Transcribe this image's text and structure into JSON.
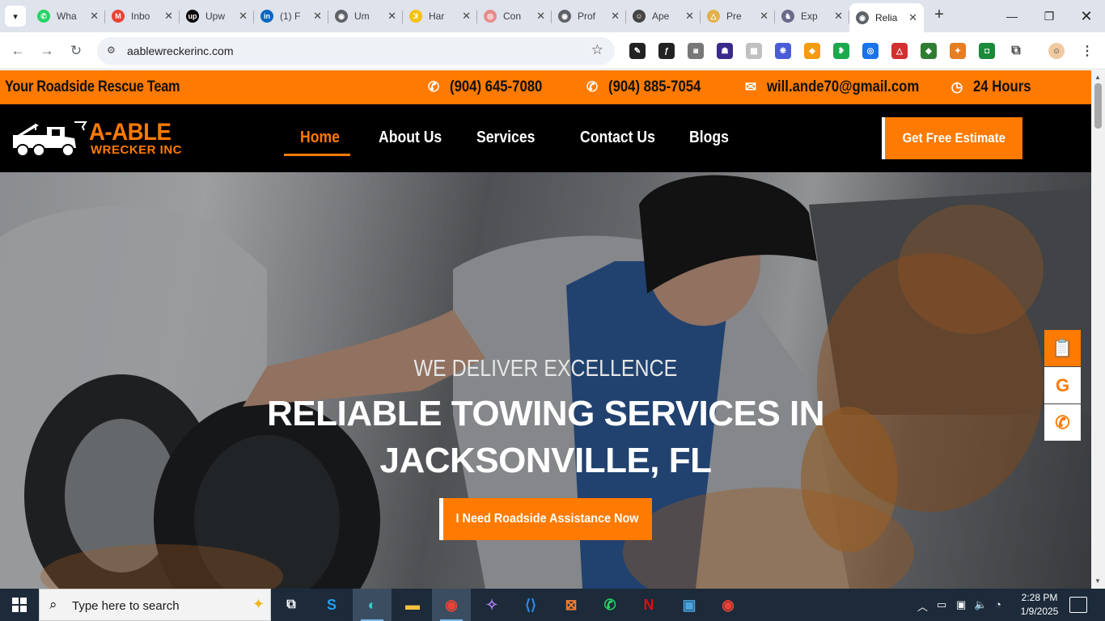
{
  "browser": {
    "tabs": [
      {
        "title": "Wha",
        "color": "#25d366",
        "glyph": "✆"
      },
      {
        "title": "Inbo",
        "color": "#ea4335",
        "glyph": "M"
      },
      {
        "title": "Upw",
        "color": "#000000",
        "glyph": "up"
      },
      {
        "title": "(1) F",
        "color": "#0a66c2",
        "glyph": "in"
      },
      {
        "title": "Um",
        "color": "#5f6368",
        "glyph": "◉"
      },
      {
        "title": "Har",
        "color": "#f4c20d",
        "glyph": "ꓘ"
      },
      {
        "title": "Con",
        "color": "#e88b8b",
        "glyph": "◎"
      },
      {
        "title": "Prof",
        "color": "#5f6368",
        "glyph": "◉"
      },
      {
        "title": "Ape",
        "color": "#444444",
        "glyph": "☺"
      },
      {
        "title": "Pre",
        "color": "#e3b04b",
        "glyph": "△"
      },
      {
        "title": "Exp",
        "color": "#6a6a8a",
        "glyph": "♞"
      },
      {
        "title": "Relia",
        "color": "#5f6368",
        "glyph": "◉",
        "active": true
      }
    ],
    "tab_close": "✕",
    "new_tab": "+",
    "url": "aablewreckerinc.com",
    "extension_colors": [
      "#222222",
      "#222222",
      "#777777",
      "#3a2a8a",
      "#c0c0c0",
      "#4a5bd6",
      "#f39c12",
      "#1ba94c",
      "#1a73e8",
      "#d32f2f",
      "#2e7d32",
      "#e67e22",
      "#1b8a3a",
      "#444444",
      "#555555"
    ]
  },
  "site": {
    "topbar": {
      "tagline": "Your Roadside Rescue Team",
      "phone1": "(904) 645-7080",
      "phone2": "(904) 885-7054",
      "email": "will.ande70@gmail.com",
      "hours": "24 Hours"
    },
    "logo": {
      "line1": "A-ABLE",
      "line2": "WRECKER INC"
    },
    "nav": [
      "Home",
      "About Us",
      "Services",
      "Contact Us",
      "Blogs"
    ],
    "nav_active": "Home",
    "estimate_button": "Get Free Estimate",
    "hero": {
      "pretitle": "WE DELIVER EXCELLENCE",
      "title_line1": "RELIABLE TOWING SERVICES IN",
      "title_line2": "JACKSONVILLE, FL",
      "cta": "I Need Roadside Assistance Now"
    },
    "side_icons": [
      "clipboard-icon",
      "google-icon",
      "phone-icon"
    ],
    "brand_color": "#ff7a00"
  },
  "taskbar": {
    "search_placeholder": "Type here to search",
    "time": "2:28 PM",
    "date": "1/9/2025",
    "apps": [
      "task-view",
      "skype",
      "edge",
      "file-explorer",
      "chrome",
      "copilot",
      "vscode",
      "xampp",
      "whatsapp",
      "netflix",
      "store",
      "chrome-profile"
    ]
  }
}
